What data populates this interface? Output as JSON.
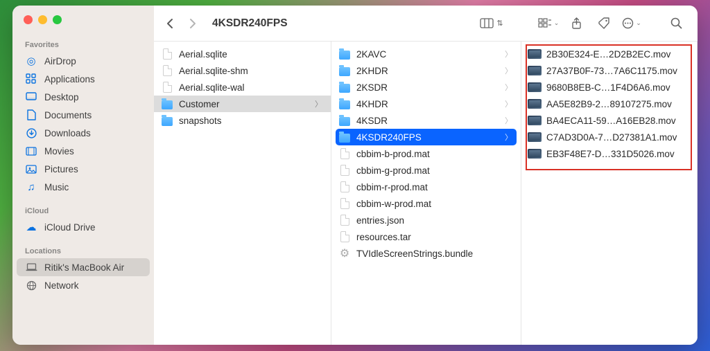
{
  "window_title": "4KSDR240FPS",
  "colors": {
    "accent_blue": "#0a64ff",
    "highlight_red": "#d93025"
  },
  "sidebar": {
    "sections": [
      {
        "title": "Favorites",
        "items": [
          {
            "label": "AirDrop",
            "icon": "airdrop"
          },
          {
            "label": "Applications",
            "icon": "apps"
          },
          {
            "label": "Desktop",
            "icon": "desktop"
          },
          {
            "label": "Documents",
            "icon": "doc"
          },
          {
            "label": "Downloads",
            "icon": "downloads"
          },
          {
            "label": "Movies",
            "icon": "movies"
          },
          {
            "label": "Pictures",
            "icon": "pictures"
          },
          {
            "label": "Music",
            "icon": "music"
          }
        ]
      },
      {
        "title": "iCloud",
        "items": [
          {
            "label": "iCloud Drive",
            "icon": "cloud"
          }
        ]
      },
      {
        "title": "Locations",
        "items": [
          {
            "label": "Ritik's MacBook Air",
            "icon": "laptop",
            "selected": true
          },
          {
            "label": "Network",
            "icon": "network"
          }
        ]
      }
    ]
  },
  "columns": [
    {
      "items": [
        {
          "label": "Aerial.sqlite",
          "type": "file"
        },
        {
          "label": "Aerial.sqlite-shm",
          "type": "file"
        },
        {
          "label": "Aerial.sqlite-wal",
          "type": "file"
        },
        {
          "label": "Customer",
          "type": "folder",
          "selected": "gray",
          "has_children": true
        },
        {
          "label": "snapshots",
          "type": "folder"
        }
      ]
    },
    {
      "items": [
        {
          "label": "2KAVC",
          "type": "folder",
          "has_children": true
        },
        {
          "label": "2KHDR",
          "type": "folder",
          "has_children": true
        },
        {
          "label": "2KSDR",
          "type": "folder",
          "has_children": true
        },
        {
          "label": "4KHDR",
          "type": "folder",
          "has_children": true
        },
        {
          "label": "4KSDR",
          "type": "folder",
          "has_children": true
        },
        {
          "label": "4KSDR240FPS",
          "type": "folder",
          "selected": "blue",
          "has_children": true
        },
        {
          "label": "cbbim-b-prod.mat",
          "type": "file"
        },
        {
          "label": "cbbim-g-prod.mat",
          "type": "file"
        },
        {
          "label": "cbbim-r-prod.mat",
          "type": "file"
        },
        {
          "label": "cbbim-w-prod.mat",
          "type": "file"
        },
        {
          "label": "entries.json",
          "type": "file"
        },
        {
          "label": "resources.tar",
          "type": "file"
        },
        {
          "label": "TVIdleScreenStrings.bundle",
          "type": "bundle"
        }
      ]
    },
    {
      "highlight": true,
      "items": [
        {
          "label": "2B30E324-E…2D2B2EC.mov",
          "type": "mov"
        },
        {
          "label": "27A37B0F-73…7A6C1175.mov",
          "type": "mov"
        },
        {
          "label": "9680B8EB-C…1F4D6A6.mov",
          "type": "mov"
        },
        {
          "label": "AA5E82B9-2…89107275.mov",
          "type": "mov"
        },
        {
          "label": "BA4ECA11-59…A16EB28.mov",
          "type": "mov"
        },
        {
          "label": "C7AD3D0A-7…D27381A1.mov",
          "type": "mov"
        },
        {
          "label": "EB3F48E7-D…331D5026.mov",
          "type": "mov"
        }
      ]
    }
  ]
}
